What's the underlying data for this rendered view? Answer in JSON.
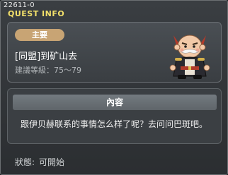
{
  "window": {
    "quest_id": "22611-0",
    "title": "QUEST INFO"
  },
  "quest": {
    "badge": "主要",
    "name": "[同盟]到矿山去",
    "level_label": "建議等級：",
    "level_range": "75～79",
    "npc_icon": "npc-portrait-icon"
  },
  "content": {
    "header": "內容",
    "text": "跟伊贝赫联系的事情怎么样了呢？去问问巴斑吧。"
  },
  "status": {
    "label": "狀態:",
    "value": "可開始"
  },
  "colors": {
    "title": "#f3e06a",
    "badge": "#c8a474",
    "header_bar": "#6b7176"
  }
}
